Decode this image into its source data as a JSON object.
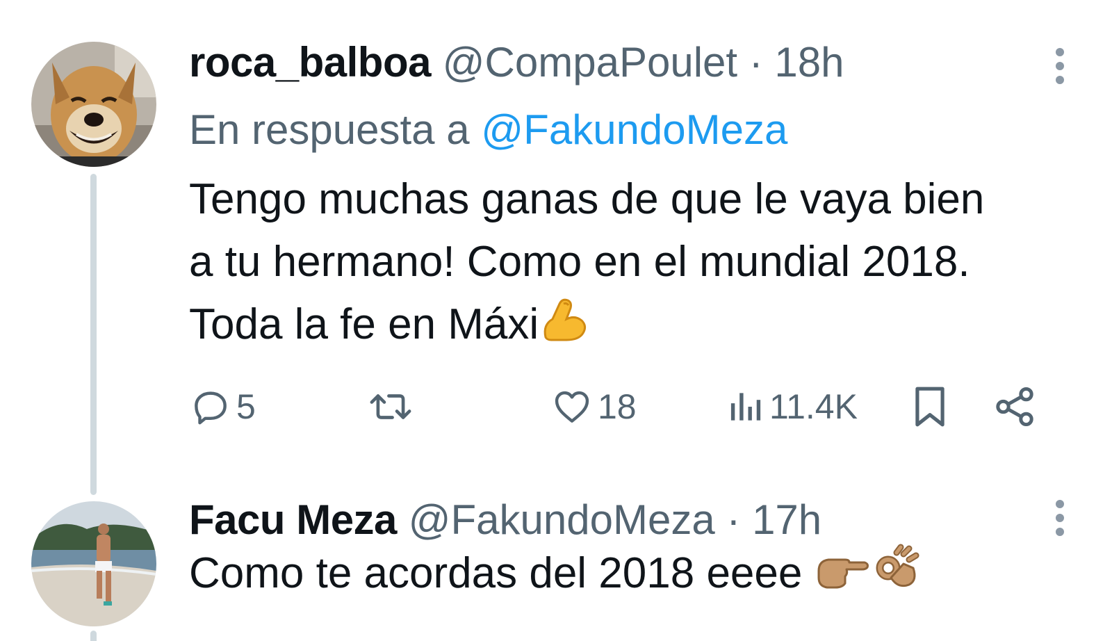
{
  "tweets": [
    {
      "display_name": "roca_balboa",
      "handle": "@CompaPoulet",
      "separator": "·",
      "time": "18h",
      "reply_prefix": "En respuesta a",
      "reply_handle": "@FakundoMeza",
      "text_lines": [
        "Tengo muchas ganas de que le vaya bien",
        "a tu hermano! Como en el mundial 2018.",
        "Toda la fe en Máxi"
      ],
      "text_emoji": "flexed-biceps-emoji",
      "actions": {
        "reply_count": "5",
        "retweet_count": "",
        "like_count": "18",
        "views_count": "11.4K"
      },
      "avatar": "smiling-dog-avatar"
    },
    {
      "display_name": "Facu Meza",
      "handle": "@FakundoMeza",
      "separator": "·",
      "time": "17h",
      "text": "Como te acordas del 2018 eeee",
      "text_emojis": [
        "pointing-right-emoji",
        "ok-hand-emoji"
      ],
      "avatar": "beach-person-avatar"
    }
  ],
  "colors": {
    "text_primary": "#0f1419",
    "text_secondary": "#536471",
    "link": "#1d9bf0",
    "thread_line": "#cfd9de"
  }
}
